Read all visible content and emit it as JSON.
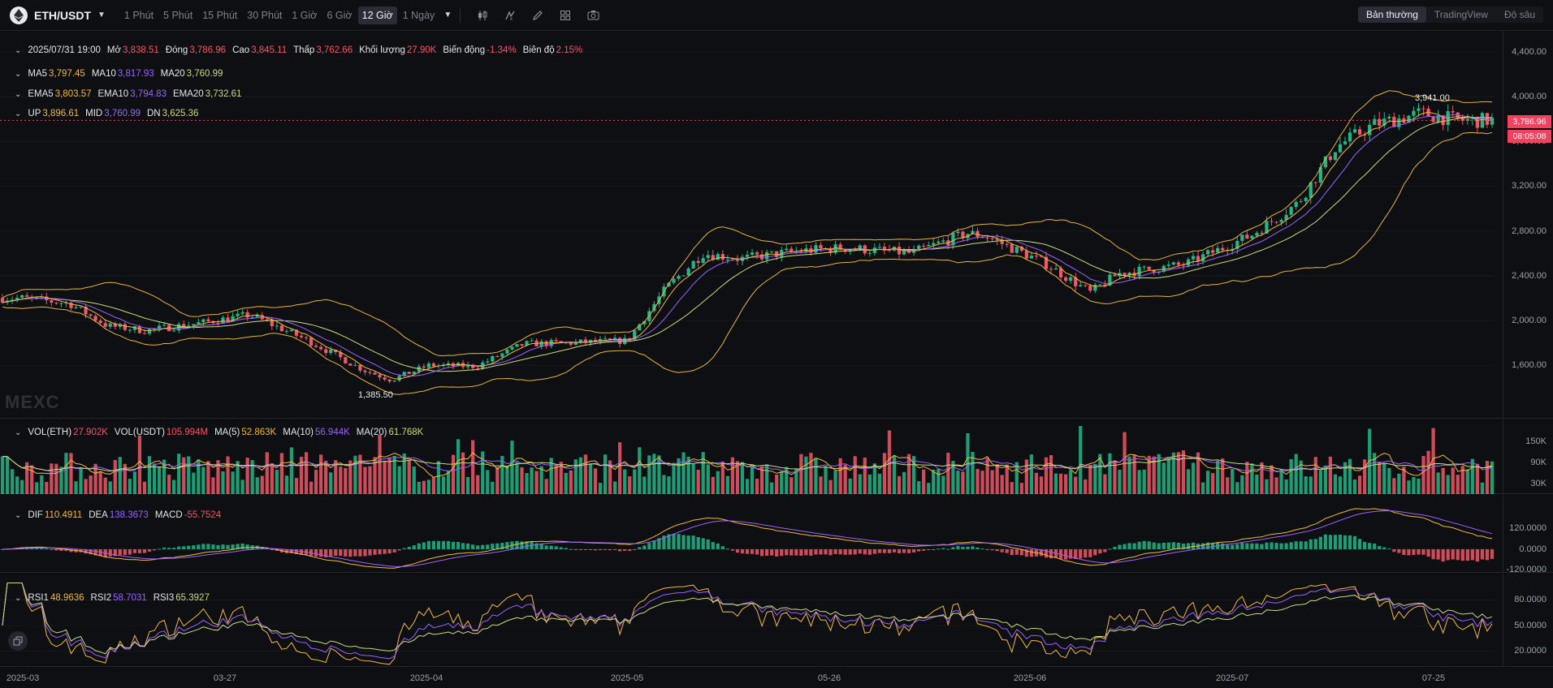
{
  "toolbar": {
    "symbol": "ETH/USDT",
    "intervals": [
      "1 Phút",
      "5 Phút",
      "15 Phút",
      "30 Phút",
      "1 Giờ",
      "6 Giờ",
      "12 Giờ",
      "1 Ngày"
    ],
    "active_interval": "12 Giờ",
    "views": [
      "Bản thường",
      "TradingView",
      "Độ sâu"
    ],
    "active_view": "Bản thường",
    "icons": [
      "candle-type-icon",
      "indicator-icon",
      "draw-icon",
      "layout-icon",
      "screenshot-icon"
    ]
  },
  "ohlc": {
    "date": "2025/07/31 19:00",
    "open_label": "Mở",
    "open": "3,838.51",
    "close_label": "Đóng",
    "close": "3,786.96",
    "high_label": "Cao",
    "high": "3,845.11",
    "low_label": "Thấp",
    "low": "3,762.66",
    "volume_label": "Khối lượng",
    "volume": "27.90K",
    "change_label": "Biến động",
    "change": "-1.34%",
    "amplitude_label": "Biên độ",
    "amplitude": "2.15%"
  },
  "ma": {
    "ma5_label": "MA5",
    "ma5": "3,797.45",
    "ma10_label": "MA10",
    "ma10": "3,817.93",
    "ma20_label": "MA20",
    "ma20": "3,760.99"
  },
  "ema": {
    "ema5_label": "EMA5",
    "ema5": "3,803.57",
    "ema10_label": "EMA10",
    "ema10": "3,794.83",
    "ema20_label": "EMA20",
    "ema20": "3,732.61"
  },
  "boll": {
    "up_label": "UP",
    "up": "3,896.61",
    "mid_label": "MID",
    "mid": "3,760.99",
    "dn_label": "DN",
    "dn": "3,625.36"
  },
  "vol": {
    "eth_label": "VOL(ETH)",
    "eth": "27.902K",
    "usdt_label": "VOL(USDT)",
    "usdt": "105.994M",
    "ma5_label": "MA(5)",
    "ma5": "52.863K",
    "ma10_label": "MA(10)",
    "ma10": "56.944K",
    "ma20_label": "MA(20)",
    "ma20": "61.768K"
  },
  "macd": {
    "dif_label": "DIF",
    "dif": "110.4911",
    "dea_label": "DEA",
    "dea": "138.3673",
    "macd_label": "MACD",
    "macd": "-55.7524"
  },
  "rsi": {
    "rsi1_label": "RSI1",
    "rsi1": "48.9636",
    "rsi2_label": "RSI2",
    "rsi2": "58.7031",
    "rsi3_label": "RSI3",
    "rsi3": "65.3927"
  },
  "price_axis": [
    "4,400.00",
    "4,000.00",
    "3,600.00",
    "3,200.00",
    "2,800.00",
    "2,400.00",
    "2,000.00",
    "1,600.00"
  ],
  "vol_axis": [
    "150K",
    "90K",
    "30K"
  ],
  "macd_axis": [
    "120.0000",
    "0.0000",
    "-120.0000"
  ],
  "rsi_axis": [
    "80.0000",
    "50.0000",
    "20.0000"
  ],
  "x_axis": [
    "2025-03",
    "03-27",
    "2025-04",
    "2025-05",
    "05-26",
    "2025-06",
    "2025-07",
    "07-25"
  ],
  "last_price": "3,786.96",
  "countdown": "08:05:08",
  "annotations": {
    "high": "3,941.00",
    "low": "1,385.50"
  },
  "watermark": "MEXC",
  "colors": {
    "up": "#1fb886",
    "down": "#f25767",
    "ma5": "#f5b93a",
    "ma10": "#9b63ff",
    "ma20": "#c8dd7b",
    "boll": "#e8b53a",
    "background": "#0e0f13"
  },
  "chart_data": {
    "type": "candlestick",
    "symbol": "ETH/USDT",
    "interval": "12 Giờ",
    "x_range": [
      "2025-03",
      "2025-07-31"
    ],
    "price_ylim": [
      1300,
      4500
    ],
    "price_path": [
      [
        "2025-03-01",
        2200
      ],
      [
        "2025-03-06",
        2150
      ],
      [
        "2025-03-10",
        1950
      ],
      [
        "2025-03-14",
        1910
      ],
      [
        "2025-03-20",
        1980
      ],
      [
        "2025-03-25",
        2050
      ],
      [
        "2025-03-31",
        1830
      ],
      [
        "2025-04-06",
        1560
      ],
      [
        "2025-04-09",
        1470
      ],
      [
        "2025-04-13",
        1600
      ],
      [
        "2025-04-18",
        1590
      ],
      [
        "2025-04-23",
        1790
      ],
      [
        "2025-04-28",
        1800
      ],
      [
        "2025-05-04",
        1820
      ],
      [
        "2025-05-08",
        2280
      ],
      [
        "2025-05-12",
        2600
      ],
      [
        "2025-05-16",
        2550
      ],
      [
        "2025-05-22",
        2620
      ],
      [
        "2025-05-27",
        2650
      ],
      [
        "2025-06-03",
        2600
      ],
      [
        "2025-06-09",
        2780
      ],
      [
        "2025-06-11",
        2750
      ],
      [
        "2025-06-17",
        2520
      ],
      [
        "2025-06-22",
        2250
      ],
      [
        "2025-06-25",
        2420
      ],
      [
        "2025-07-02",
        2500
      ],
      [
        "2025-07-09",
        2760
      ],
      [
        "2025-07-14",
        3050
      ],
      [
        "2025-07-18",
        3550
      ],
      [
        "2025-07-22",
        3750
      ],
      [
        "2025-07-27",
        3850
      ],
      [
        "2025-07-31",
        3787
      ]
    ],
    "marked_high": 3941.0,
    "marked_low": 1385.5,
    "last_close": 3786.96
  }
}
